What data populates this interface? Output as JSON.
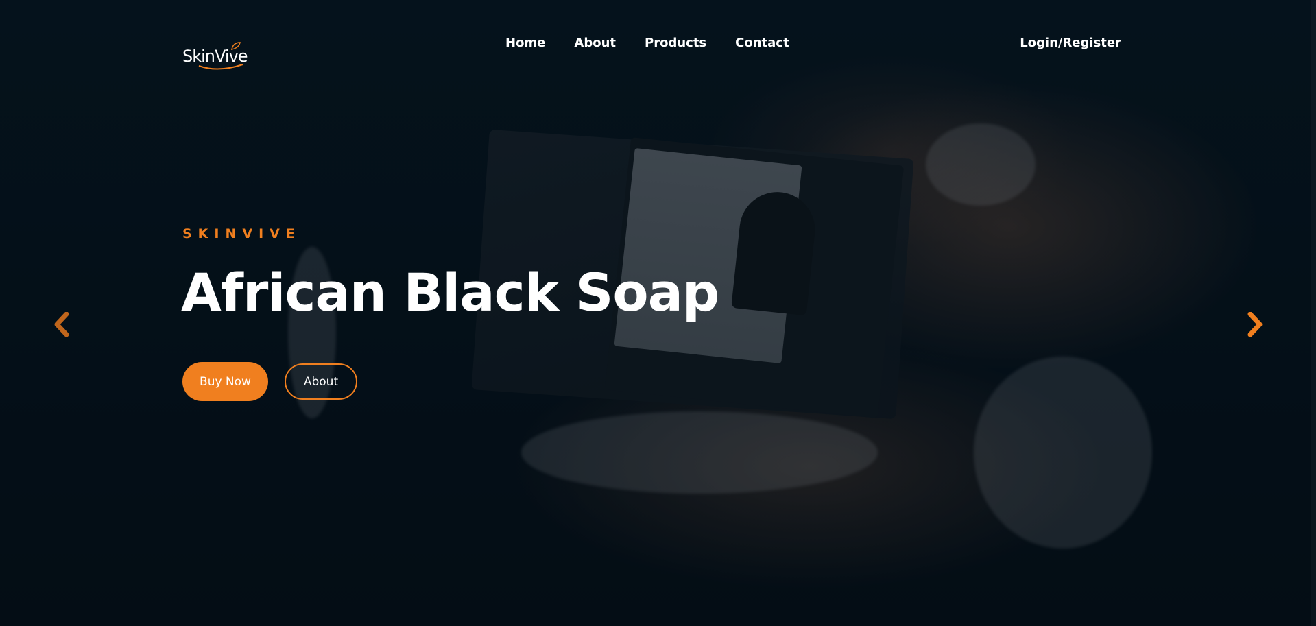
{
  "brand": {
    "logo_text": "SkinVive",
    "accent_color": "#f07f1f"
  },
  "nav": {
    "items": [
      {
        "label": "Home"
      },
      {
        "label": "About"
      },
      {
        "label": "Products"
      },
      {
        "label": "Contact"
      }
    ],
    "login_label": "Login/Register"
  },
  "hero": {
    "eyebrow": "SKINVIVE",
    "headline": "African Black Soap",
    "buy_button": "Buy Now",
    "about_button": "About",
    "prev_icon": "chevron-left-icon",
    "next_icon": "chevron-right-icon"
  }
}
